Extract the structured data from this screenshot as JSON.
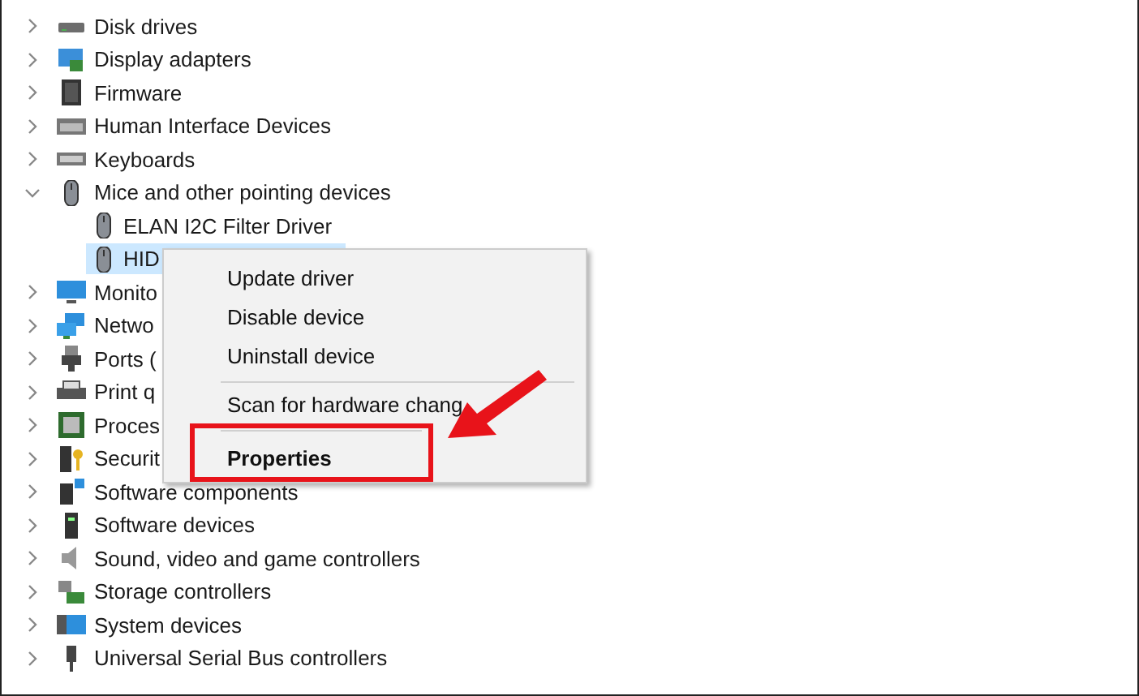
{
  "tree": [
    {
      "label": "Disk drives",
      "kind": "disk",
      "expanded": false
    },
    {
      "label": "Display adapters",
      "kind": "display",
      "expanded": false
    },
    {
      "label": "Firmware",
      "kind": "chip",
      "expanded": false
    },
    {
      "label": "Human Interface Devices",
      "kind": "hid",
      "expanded": false
    },
    {
      "label": "Keyboards",
      "kind": "keyboard",
      "expanded": false
    },
    {
      "label": "Mice and other pointing devices",
      "kind": "mouse",
      "expanded": true,
      "children": [
        {
          "label": "ELAN I2C Filter Driver",
          "kind": "mouse",
          "selected": false
        },
        {
          "label": "HID",
          "kind": "mouse",
          "selected": true
        }
      ]
    },
    {
      "label": "Monito",
      "kind": "monitor",
      "expanded": false
    },
    {
      "label": "Netwo",
      "kind": "network",
      "expanded": false
    },
    {
      "label": "Ports (",
      "kind": "port",
      "expanded": false
    },
    {
      "label": "Print q",
      "kind": "printer",
      "expanded": false
    },
    {
      "label": "Proces",
      "kind": "processor",
      "expanded": false
    },
    {
      "label": "Securit",
      "kind": "security",
      "expanded": false
    },
    {
      "label": "Software components",
      "kind": "software",
      "expanded": false
    },
    {
      "label": "Software devices",
      "kind": "softdev",
      "expanded": false
    },
    {
      "label": "Sound, video and game controllers",
      "kind": "sound",
      "expanded": false
    },
    {
      "label": "Storage controllers",
      "kind": "storage",
      "expanded": false
    },
    {
      "label": "System devices",
      "kind": "system",
      "expanded": false
    },
    {
      "label": "Universal Serial Bus controllers",
      "kind": "usb",
      "expanded": false
    }
  ],
  "context_menu": [
    {
      "label": "Update driver",
      "separator_before": false,
      "default": false,
      "highlighted": false
    },
    {
      "label": "Disable device",
      "separator_before": false,
      "default": false,
      "highlighted": false
    },
    {
      "label": "Uninstall device",
      "separator_before": false,
      "default": false,
      "highlighted": false
    },
    {
      "label": "Scan for hardware chang",
      "separator_before": true,
      "default": false,
      "highlighted": false
    },
    {
      "label": "Properties",
      "separator_before": true,
      "default": true,
      "highlighted": true
    }
  ],
  "annotation": {
    "kind": "arrow"
  }
}
